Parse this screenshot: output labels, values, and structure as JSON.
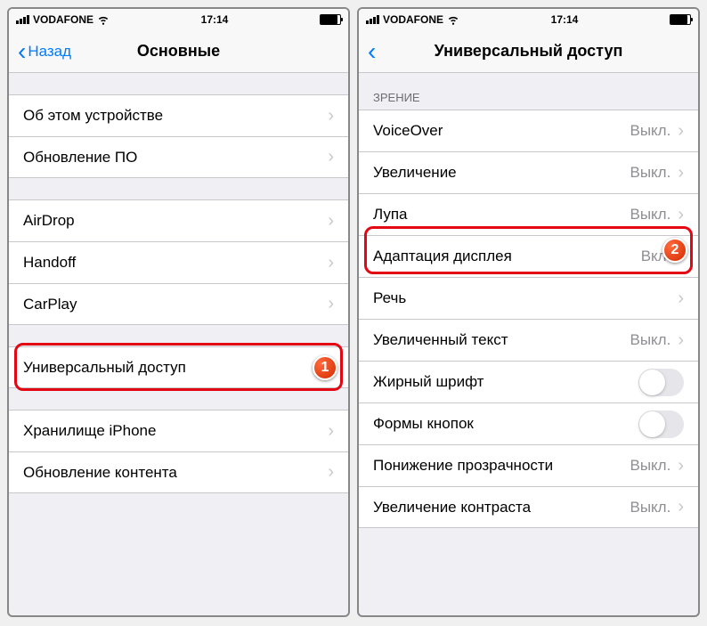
{
  "status": {
    "carrier": "VODAFONE",
    "time": "17:14"
  },
  "left": {
    "nav": {
      "back": "Назад",
      "title": "Основные"
    },
    "g1": [
      {
        "label": "Об этом устройстве"
      },
      {
        "label": "Обновление ПО"
      }
    ],
    "g2": [
      {
        "label": "AirDrop"
      },
      {
        "label": "Handoff"
      },
      {
        "label": "CarPlay"
      }
    ],
    "g3": [
      {
        "label": "Универсальный доступ"
      }
    ],
    "g4": [
      {
        "label": "Хранилище iPhone"
      },
      {
        "label": "Обновление контента"
      }
    ]
  },
  "right": {
    "nav": {
      "title": "Универсальный доступ"
    },
    "section_header": "Зрение",
    "rows": [
      {
        "label": "VoiceOver",
        "value": "Выкл."
      },
      {
        "label": "Увеличение",
        "value": "Выкл."
      },
      {
        "label": "Лупа",
        "value": "Выкл."
      },
      {
        "label": "Адаптация дисплея",
        "value": "Вкл."
      },
      {
        "label": "Речь"
      },
      {
        "label": "Увеличенный текст",
        "value": "Выкл."
      }
    ],
    "toggles": [
      {
        "label": "Жирный шрифт",
        "on": false
      },
      {
        "label": "Формы кнопок",
        "on": false
      }
    ],
    "rows2": [
      {
        "label": "Понижение прозрачности",
        "value": "Выкл."
      },
      {
        "label": "Увеличение контраста",
        "value": "Выкл."
      }
    ]
  },
  "badges": {
    "one": "1",
    "two": "2"
  }
}
